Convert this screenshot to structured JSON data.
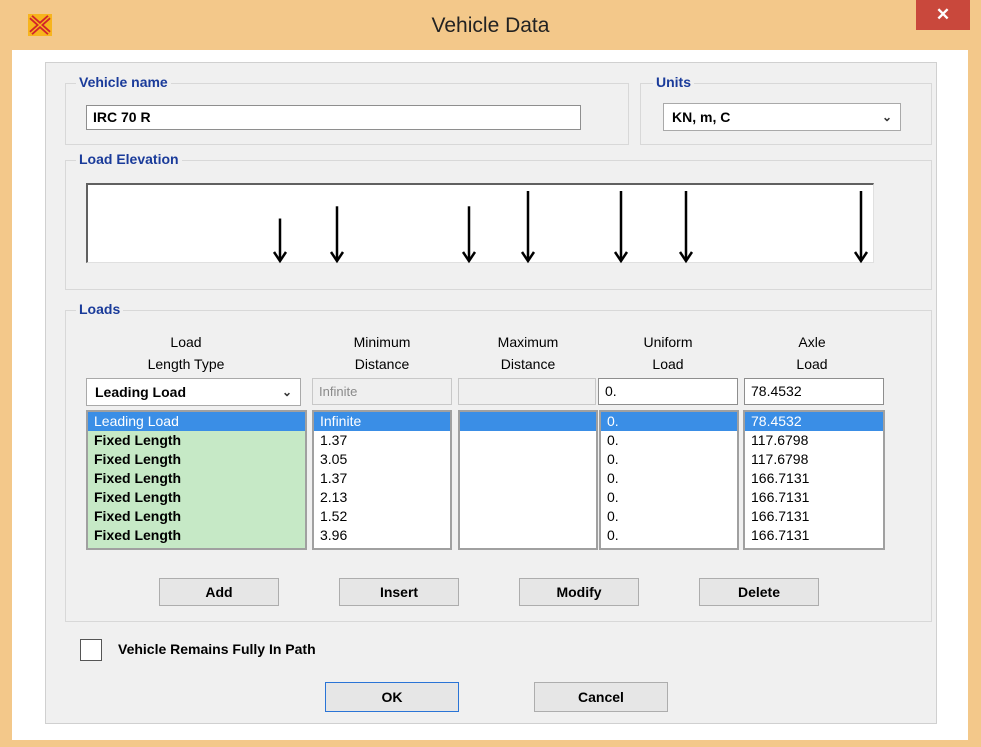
{
  "window": {
    "title": "Vehicle Data",
    "close_label": "✕"
  },
  "vehicle_name": {
    "legend": "Vehicle name",
    "value": "IRC 70 R"
  },
  "units": {
    "legend": "Units",
    "selected": "KN, m, C"
  },
  "load_elevation": {
    "legend": "Load Elevation",
    "arrows": [
      {
        "magnitude": 78.4532
      },
      {
        "magnitude": 117.6798
      },
      {
        "magnitude": 117.6798
      },
      {
        "magnitude": 166.7131
      },
      {
        "magnitude": 166.7131
      },
      {
        "magnitude": 166.7131
      },
      {
        "magnitude": 166.7131
      }
    ]
  },
  "loads": {
    "legend": "Loads",
    "headers": {
      "load_length_type": [
        "Load",
        "Length Type"
      ],
      "minimum_distance": [
        "Minimum",
        "Distance"
      ],
      "maximum_distance": [
        "Maximum",
        "Distance"
      ],
      "uniform_load": [
        "Uniform",
        "Load"
      ],
      "axle_load": [
        "Axle",
        "Load"
      ]
    },
    "edit_row": {
      "load_length_type": "Leading Load",
      "minimum_distance": "Infinite",
      "maximum_distance": "",
      "uniform_load": "0.",
      "axle_load": "78.4532"
    },
    "rows": [
      {
        "type": "Leading Load",
        "min": "Infinite",
        "max": "",
        "uniform": "0.",
        "axle": "78.4532"
      },
      {
        "type": "Fixed Length",
        "min": "1.37",
        "max": "",
        "uniform": "0.",
        "axle": "117.6798"
      },
      {
        "type": "Fixed Length",
        "min": "3.05",
        "max": "",
        "uniform": "0.",
        "axle": "117.6798"
      },
      {
        "type": "Fixed Length",
        "min": "1.37",
        "max": "",
        "uniform": "0.",
        "axle": "166.7131"
      },
      {
        "type": "Fixed Length",
        "min": "2.13",
        "max": "",
        "uniform": "0.",
        "axle": "166.7131"
      },
      {
        "type": "Fixed Length",
        "min": "1.52",
        "max": "",
        "uniform": "0.",
        "axle": "166.7131"
      },
      {
        "type": "Fixed Length",
        "min": "3.96",
        "max": "",
        "uniform": "0.",
        "axle": "166.7131"
      }
    ],
    "buttons": {
      "add": "Add",
      "insert": "Insert",
      "modify": "Modify",
      "delete": "Delete"
    }
  },
  "vehicle_remains": {
    "label": "Vehicle Remains Fully In Path",
    "checked": false
  },
  "footer": {
    "ok": "OK",
    "cancel": "Cancel"
  },
  "colors": {
    "titlebar": "#f3c88a",
    "close": "#c9483c",
    "legend": "#1a3b9a",
    "selection": "#3a8ee6",
    "type_list": "#c6e9c6"
  }
}
